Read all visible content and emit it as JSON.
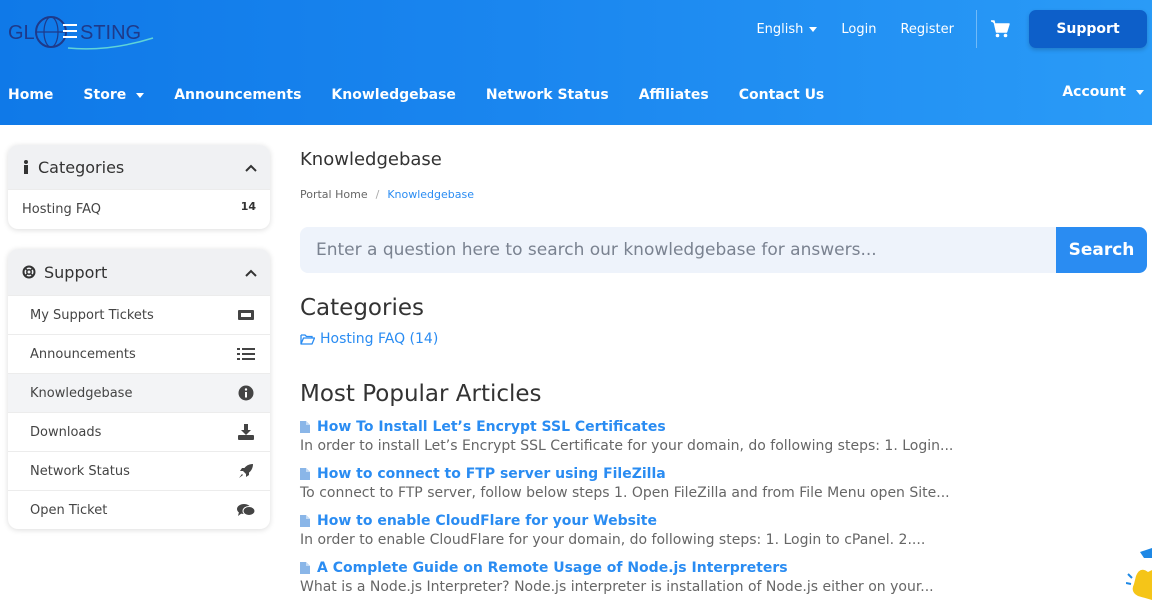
{
  "header": {
    "logo": {
      "left": "GL",
      "right": "STING"
    },
    "top_links": {
      "language": "English",
      "login": "Login",
      "register": "Register"
    },
    "support_label": "Support",
    "nav": [
      "Home",
      "Store",
      "Announcements",
      "Knowledgebase",
      "Network Status",
      "Affiliates",
      "Contact Us"
    ],
    "account_label": "Account"
  },
  "sidebar": {
    "categories": {
      "title": "Categories",
      "items": [
        {
          "label": "Hosting FAQ",
          "count": "14"
        }
      ]
    },
    "support": {
      "title": "Support",
      "items": [
        {
          "label": "My Support Tickets",
          "icon": "ticket-icon"
        },
        {
          "label": "Announcements",
          "icon": "list-icon"
        },
        {
          "label": "Knowledgebase",
          "icon": "info-circle-icon"
        },
        {
          "label": "Downloads",
          "icon": "download-icon"
        },
        {
          "label": "Network Status",
          "icon": "rocket-icon"
        },
        {
          "label": "Open Ticket",
          "icon": "comments-icon"
        }
      ]
    }
  },
  "main": {
    "title": "Knowledgebase",
    "breadcrumb": [
      "Portal Home",
      "Knowledgebase"
    ],
    "search": {
      "placeholder": "Enter a question here to search our knowledgebase for answers...",
      "button": "Search"
    },
    "categories_title": "Categories",
    "category_link": "Hosting FAQ (14)",
    "popular_title": "Most Popular Articles",
    "articles": [
      {
        "title": "How To Install Let’s Encrypt SSL Certificates",
        "desc": "In order to install Let’s Encrypt SSL Certificate for your domain, do following steps: 1. Login..."
      },
      {
        "title": "How to connect to FTP server using FileZilla",
        "desc": "To connect to FTP server, follow below steps 1. Open FileZilla and from File Menu open Site..."
      },
      {
        "title": "How to enable CloudFlare for your Website",
        "desc": "In order to enable CloudFlare for your domain, do following steps: 1. Login to cPanel. 2...."
      },
      {
        "title": "A Complete Guide on Remote Usage of Node.js Interpreters",
        "desc": "What is a Node.js Interpreter? Node.js interpreter is installation of Node.js either on your..."
      }
    ]
  },
  "colors": {
    "accent": "#2a8cf2",
    "header_start": "#0f79e8",
    "header_end": "#2a9bf7",
    "support_button": "#0d5fc9"
  }
}
